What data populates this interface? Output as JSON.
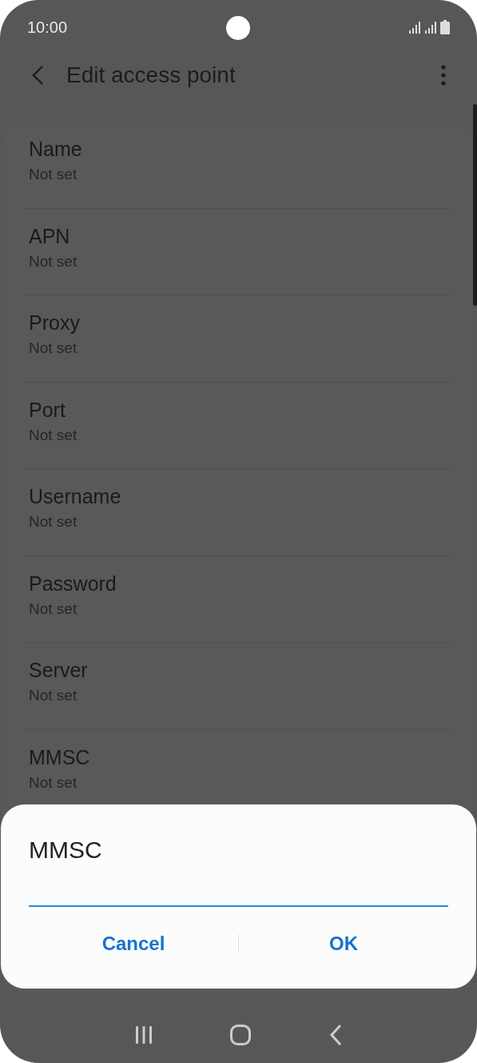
{
  "status_bar": {
    "time": "10:00"
  },
  "app_bar": {
    "title": "Edit access point"
  },
  "settings": [
    {
      "title": "Name",
      "value": "Not set"
    },
    {
      "title": "APN",
      "value": "Not set"
    },
    {
      "title": "Proxy",
      "value": "Not set"
    },
    {
      "title": "Port",
      "value": "Not set"
    },
    {
      "title": "Username",
      "value": "Not set"
    },
    {
      "title": "Password",
      "value": "Not set"
    },
    {
      "title": "Server",
      "value": "Not set"
    },
    {
      "title": "MMSC",
      "value": "Not set"
    }
  ],
  "dialog": {
    "title": "MMSC",
    "buttons": [
      "Cancel",
      "OK"
    ]
  }
}
